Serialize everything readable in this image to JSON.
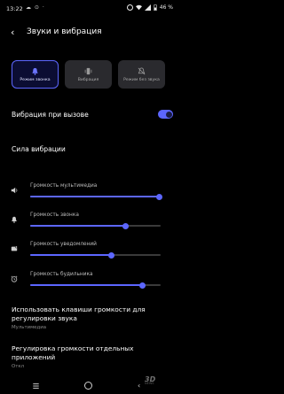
{
  "status": {
    "time": "13:22",
    "left_icons": "☁ ⊙ ·",
    "battery": "46 %"
  },
  "header": {
    "title": "Звуки и вибрация"
  },
  "modes": [
    {
      "label": "Режим звонка",
      "icon": "bell-icon",
      "active": true
    },
    {
      "label": "Вибрация",
      "icon": "vibrate-icon",
      "active": false
    },
    {
      "label": "Режим без звука",
      "icon": "bell-off-icon",
      "active": false
    }
  ],
  "vibration_on_call": {
    "label": "Вибрация при вызове",
    "enabled": true
  },
  "vibration_strength": {
    "label": "Сила вибрации"
  },
  "sliders": [
    {
      "label": "Громкость мультимедиа",
      "icon": "speaker-icon",
      "level": 0.99
    },
    {
      "label": "Громкость звонка",
      "icon": "bell-icon",
      "level": 0.73
    },
    {
      "label": "Громкость уведомлений",
      "icon": "notification-icon",
      "level": 0.62
    },
    {
      "label": "Громкость будильника",
      "icon": "alarm-icon",
      "level": 0.86
    }
  ],
  "volume_keys": {
    "title": "Использовать клавиши громкости для регулировки звука",
    "subtitle": "Мультимедиа"
  },
  "separate_apps": {
    "title": "Регулировка громкости отдельных приложений",
    "subtitle": "Откл"
  },
  "colors": {
    "accent": "#5c66ff",
    "background": "#000000"
  },
  "watermark": {
    "text": "3D",
    "sub": "NEWS"
  }
}
